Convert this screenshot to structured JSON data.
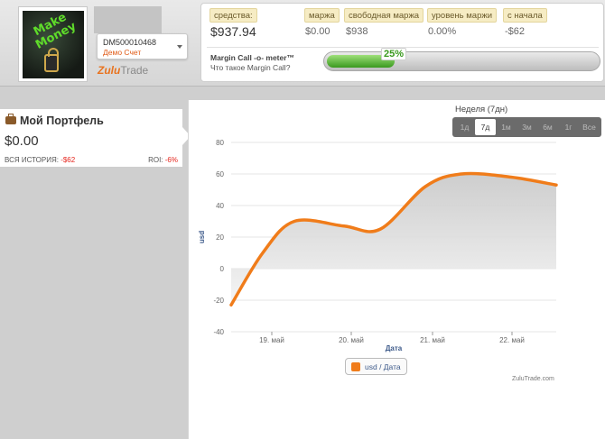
{
  "header": {
    "avatar_text": "Make Money",
    "account_id": "DM500010468",
    "account_type": "Демо Счет",
    "brand_a": "Zulu",
    "brand_b": "Trade"
  },
  "stats": {
    "equity_label": "средства:",
    "equity_value": "$937.94",
    "margin_label": "маржа",
    "margin_value": "$0.00",
    "free_margin_label": "свободная маржа",
    "free_margin_value": "$938",
    "margin_level_label": "уровень маржи",
    "margin_level_value": "0.00%",
    "since_start_label": "с начала",
    "since_start_value": "-$62"
  },
  "margin_call": {
    "title": "Margin Call -o- meter™",
    "link": "Что такое Margin Call?",
    "percent_label": "25%",
    "percent": 25
  },
  "portfolio": {
    "title": "Мой Портфель",
    "value": "$0.00",
    "history_label": "ВСЯ ИСТОРИЯ:",
    "history_value": "-$62",
    "roi_label": "ROI:",
    "roi_value": "-6%"
  },
  "range": {
    "title": "Неделя (7дн)",
    "buttons": [
      "1д",
      "7д",
      "1м",
      "3м",
      "6м",
      "1г",
      "Все"
    ],
    "active_index": 1
  },
  "chart_data": {
    "type": "area",
    "x": [
      "18. май 12:00",
      "19. май",
      "19. май 12:00",
      "20. май",
      "20. май 12:00",
      "21. май",
      "21. май 12:00",
      "22. май",
      "22. май 12:00"
    ],
    "x_ticks": [
      "19. май",
      "20. май",
      "21. май",
      "22. май"
    ],
    "series": [
      {
        "name": "usd / Дата",
        "values": [
          -23,
          10,
          30,
          27,
          25,
          52,
          60,
          58,
          53
        ]
      }
    ],
    "xlabel": "Дата",
    "ylabel": "usd",
    "ylim": [
      -40,
      80
    ],
    "yticks": [
      -40,
      -20,
      0,
      20,
      40,
      60,
      80
    ],
    "grid": true,
    "legend_position": "bottom",
    "credit": "ZuluTrade.com",
    "line_color": "#f07c1a"
  }
}
